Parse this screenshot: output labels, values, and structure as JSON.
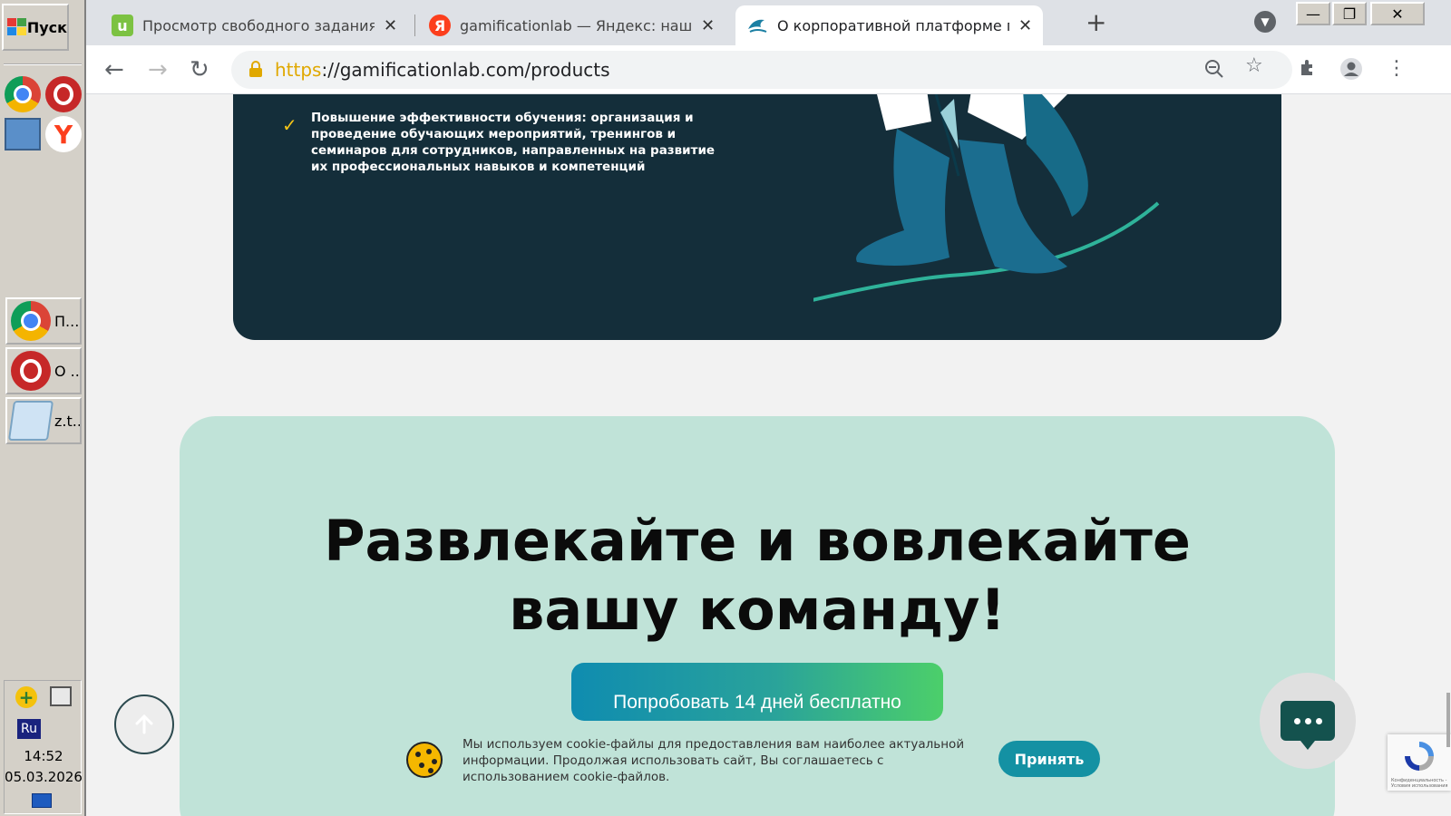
{
  "taskbar": {
    "start_label": "Пуск",
    "tasks": [
      {
        "label": "П...",
        "icon": "chrome-icon"
      },
      {
        "label": "О ..",
        "icon": "opera-icon"
      },
      {
        "label": "z.t...",
        "icon": "notepad-icon"
      }
    ],
    "tray": {
      "lang": "Ru",
      "time": "14:52",
      "date": "05.03.2026"
    }
  },
  "browser": {
    "tabs": [
      {
        "title": "Просмотр свободного задания - В",
        "favicon": "u",
        "favicon_color": "#7cc242"
      },
      {
        "title": "gamificationlab — Яндекс: нашёлся",
        "favicon": "Я",
        "favicon_color": "#fc3f1d"
      },
      {
        "title": "О корпоративной платформе гейм",
        "favicon": "",
        "favicon_color": "#1b7fa3",
        "active": true
      }
    ],
    "url_scheme": "https",
    "url_rest": "://gamificationlab.com/products"
  },
  "page": {
    "bullet": "Повышение эффективности обучения: организация и проведение обучающих мероприятий, тренингов и семинаров для сотрудников, направленных на развитие их профессиональных навыков и компетенций",
    "cta_heading_line1": "Развлекайте и вовлекайте",
    "cta_heading_line2": "вашу команду!",
    "cta_button": "Попробовать 14 дней бесплатно",
    "cookie_text": "Мы используем cookie-файлы для предоставления вам наиболее актуальной информации. Продолжая использовать сайт, Вы соглашаетесь с использованием cookie-файлов.",
    "cookie_accept": "Принять",
    "recaptcha_text": "Конфиденциальность - Условия использования"
  },
  "colors": {
    "dark_card": "#142e3a",
    "cta_card": "#c0e3d8",
    "accept": "#1491a3",
    "check": "#f5c518"
  }
}
